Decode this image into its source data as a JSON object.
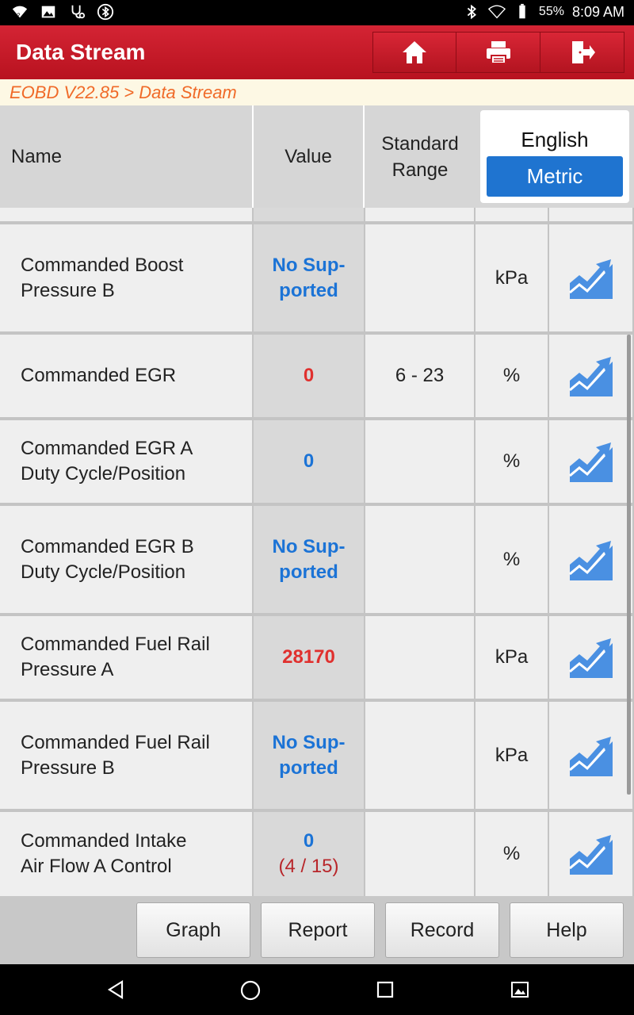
{
  "status_bar": {
    "battery": "55%",
    "time": "8:09 AM"
  },
  "app_bar": {
    "title": "Data Stream"
  },
  "breadcrumb": "EOBD V22.85 > Data Stream",
  "table_header": {
    "name": "Name",
    "value": "Value",
    "range_line1": "Standard",
    "range_line2": "Range",
    "unit_option_1": "English",
    "unit_option_2": "Metric",
    "selected_unit": "Metric"
  },
  "rows": [
    {
      "name_1": "Commanded Boost",
      "name_2": "Pressure B",
      "value_1": "No Sup-",
      "value_2": "ported",
      "value_color": "blue",
      "range": "",
      "unit": "kPa"
    },
    {
      "name_1": "Commanded EGR",
      "name_2": "",
      "value_1": "0",
      "value_2": "",
      "value_color": "red",
      "range": "6 - 23",
      "unit": "%"
    },
    {
      "name_1": "Commanded EGR A",
      "name_2": "Duty Cycle/Position",
      "value_1": "0",
      "value_2": "",
      "value_color": "blue",
      "range": "",
      "unit": "%"
    },
    {
      "name_1": "Commanded EGR B",
      "name_2": "Duty Cycle/Position",
      "value_1": "No Sup-",
      "value_2": "ported",
      "value_color": "blue",
      "range": "",
      "unit": "%"
    },
    {
      "name_1": "Commanded Fuel Rail",
      "name_2": "Pressure A",
      "value_1": "28170",
      "value_2": "",
      "value_color": "red",
      "range": "",
      "unit": "kPa"
    },
    {
      "name_1": "Commanded Fuel Rail",
      "name_2": "Pressure B",
      "value_1": "No Sup-",
      "value_2": "ported",
      "value_color": "blue",
      "range": "",
      "unit": "kPa"
    },
    {
      "name_1": "Commanded Intake",
      "name_2": "Air Flow A Control",
      "value_1": "0",
      "value_2": "(4 / 15)",
      "value_color": "blue",
      "range": "",
      "unit": "%"
    }
  ],
  "bottom_buttons": {
    "graph": "Graph",
    "report": "Report",
    "record": "Record",
    "help": "Help"
  },
  "colors": {
    "accent": "#c8182a",
    "value_blue": "#1b73d6",
    "value_red": "#e0302e",
    "metric_selected": "#1f74d0"
  }
}
